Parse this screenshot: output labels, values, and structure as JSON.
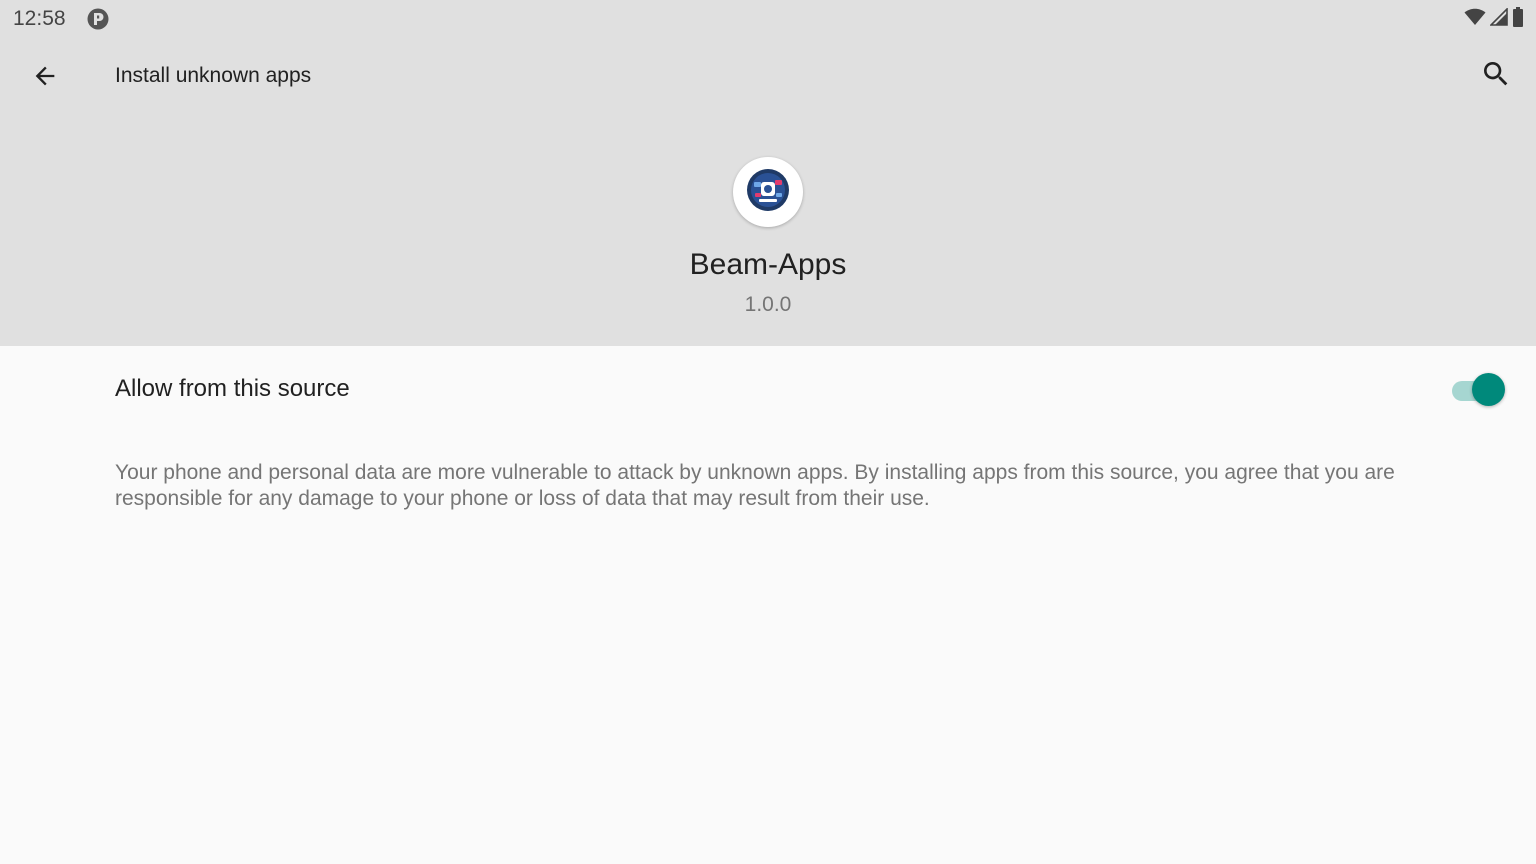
{
  "status_bar": {
    "time": "12:58",
    "icons": [
      "notification-p-icon",
      "wifi-icon",
      "cell-signal-icon",
      "battery-icon"
    ]
  },
  "toolbar": {
    "title": "Install unknown apps",
    "back_icon": "arrow-back-icon",
    "search_icon": "search-icon"
  },
  "app": {
    "name": "Beam-Apps",
    "version": "1.0.0",
    "icon": "beam-apps-logo"
  },
  "setting": {
    "label": "Allow from this source",
    "enabled": true
  },
  "description": "Your phone and personal data are more vulnerable to attack by unknown apps. By installing apps from this source, you agree that you are responsible for any damage to your phone or loss of data that may result from their use.",
  "colors": {
    "header_bg": "#e0e0e0",
    "body_bg": "#fafafa",
    "accent": "#00897b",
    "accent_track": "#a6d6d1"
  }
}
